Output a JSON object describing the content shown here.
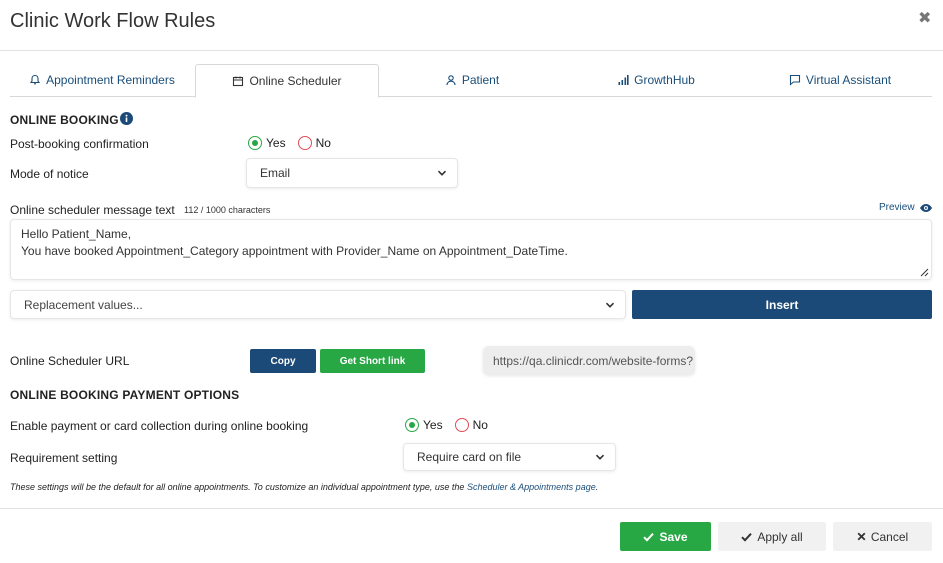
{
  "modal": {
    "title": "Clinic Work Flow Rules",
    "close_glyph": "✖"
  },
  "tabs": [
    {
      "label": "Appointment Reminders",
      "icon": "bell-icon"
    },
    {
      "label": "Online Scheduler",
      "icon": "calendar-icon",
      "active": true
    },
    {
      "label": "Patient",
      "icon": "user-icon"
    },
    {
      "label": "GrowthHub",
      "icon": "bar-chart-icon"
    },
    {
      "label": "Virtual Assistant",
      "icon": "chat-icon"
    }
  ],
  "online_booking": {
    "heading": "ONLINE BOOKING",
    "post_booking": {
      "label": "Post-booking confirmation",
      "yes": "Yes",
      "no": "No",
      "selected": "Yes"
    },
    "mode_of_notice": {
      "label": "Mode of notice",
      "value": "Email"
    },
    "message": {
      "label": "Online scheduler message text",
      "char_count": "112 / 1000 characters",
      "preview_label": "Preview",
      "line1": "Hello Patient_Name,",
      "line2": "You have booked Appointment_Category appointment with Provider_Name on Appointment_DateTime."
    },
    "replacement": {
      "placeholder": "Replacement values...",
      "insert_label": "Insert"
    },
    "url": {
      "label": "Online Scheduler URL",
      "copy_label": "Copy",
      "short_link_label": "Get Short link",
      "value": "https://qa.clinicdr.com/website-forms?"
    }
  },
  "payment": {
    "heading": "ONLINE BOOKING PAYMENT OPTIONS",
    "enable": {
      "label": "Enable payment or card collection during online booking",
      "yes": "Yes",
      "no": "No",
      "selected": "Yes"
    },
    "requirement": {
      "label": "Requirement setting",
      "value": "Require card on file"
    },
    "note_text": "These settings will be the default for all online appointments. To customize an individual appointment type, use the ",
    "note_link": "Scheduler & Appointments page",
    "note_end": "."
  },
  "footer": {
    "save_label": "Save",
    "apply_all_label": "Apply all",
    "cancel_label": "Cancel"
  },
  "colors": {
    "primary": "#1c4a78",
    "success": "#28a745",
    "radio_off": "#e14b59"
  }
}
